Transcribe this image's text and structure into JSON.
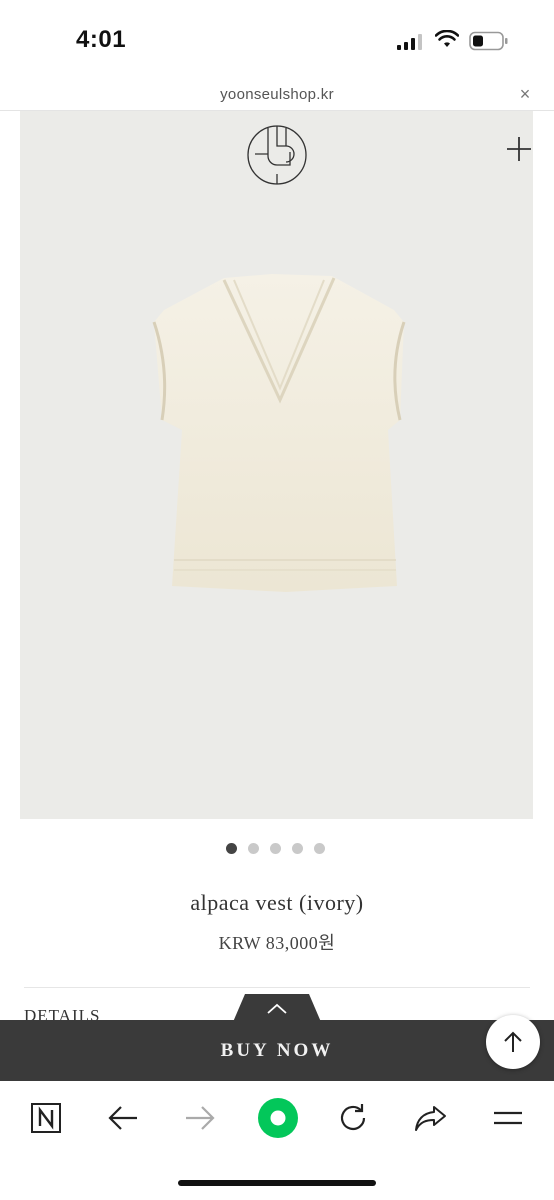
{
  "status_bar": {
    "time": "4:01"
  },
  "browser": {
    "url": "yoonseulshop.kr",
    "close_label": "×"
  },
  "gallery": {
    "slide_count": 5,
    "active_index": 0
  },
  "product": {
    "name": "alpaca vest (ivory)",
    "price": "KRW 83,000원",
    "details_label": "DETAILS"
  },
  "buy_bar": {
    "label": "BUY NOW"
  },
  "icons": {
    "logo": "brand-logo-icon",
    "plus": "plus-icon",
    "expand": "chevron-up-icon",
    "scroll_top": "arrow-up-icon",
    "toolbar": [
      "naver-n-icon",
      "back-arrow-icon",
      "forward-arrow-icon",
      "green-home-icon",
      "reload-icon",
      "share-icon",
      "menu-icon"
    ]
  },
  "colors": {
    "buy_bar": "#3a3a3a",
    "accent_green": "#03c75a",
    "photo_bg": "#ebebe8",
    "vest": "#f1ecdd"
  }
}
